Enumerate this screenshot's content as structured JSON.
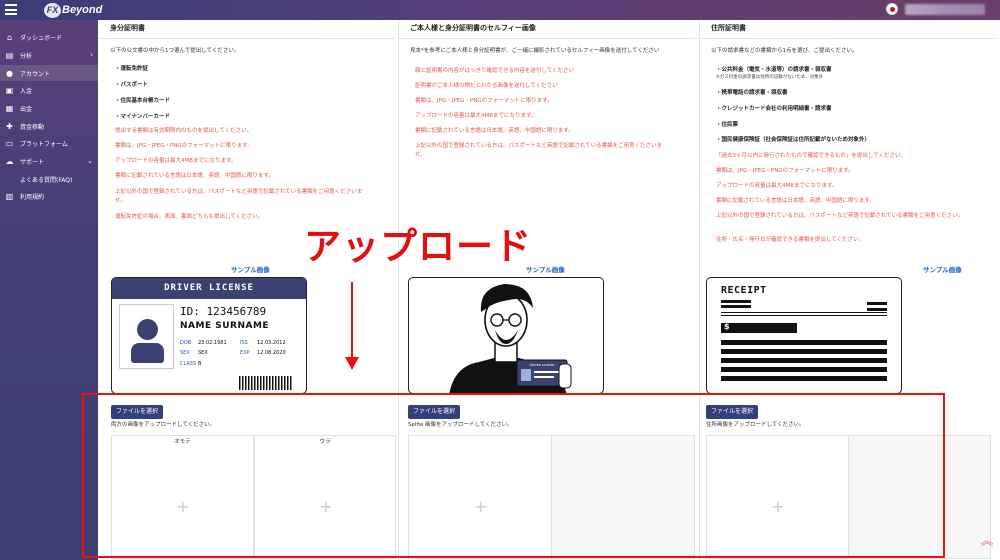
{
  "header": {
    "logo_mark": "FX",
    "logo_text": "Beyond"
  },
  "sidebar": {
    "items": [
      {
        "label": "ダッシュボード",
        "icon": "home-icon"
      },
      {
        "label": "分析",
        "icon": "chart-icon"
      },
      {
        "label": "アカウント",
        "icon": "users-icon"
      },
      {
        "label": "入金",
        "icon": "deposit-icon"
      },
      {
        "label": "出金",
        "icon": "withdraw-icon"
      },
      {
        "label": "資金移動",
        "icon": "transfer-icon"
      },
      {
        "label": "プラットフォーム",
        "icon": "platform-icon"
      },
      {
        "label": "サポート",
        "icon": "support-icon"
      },
      {
        "label": "よくある質問(FAQ)",
        "icon": ""
      },
      {
        "label": "利用規約",
        "icon": "terms-icon"
      }
    ]
  },
  "columns": [
    {
      "title": "身分証明書",
      "intro": "以下の公文書の中から1つ選んで提出してください。",
      "requirements": [
        "・運転免許証",
        "・パスポート",
        "・住民基本台帳カード",
        "・マイナンバーカード"
      ],
      "notes": [
        "提出する書類は有効期限内のものを提出してください。",
        "書類は、JPG・JPEG・PNGのフォーマットに限ります。",
        "アップロードの容量は最大4MBまでになります。",
        "書類に記載されている言語は日本語、英語、中国語に限ります。",
        "上記以外の国で登録されている方は、パスポートなど英語で記載されている書類をご用意くださいま",
        "せ。",
        "運転免許証の場合、表面、裏面どちらも提出してください。"
      ],
      "sample_label": "サンプル画像",
      "upload_button": "ファイルを選択",
      "upload_hint": "両方の画像をアップロードしてください。",
      "drop_labels": [
        "オモテ",
        "ウラ"
      ]
    },
    {
      "title": "ご本人様と身分証明書のセルフィー画像",
      "intro": "見本*を参考にご本人様と身分証明書が、ご一緒に撮影されているセルフィー画像を送付してください",
      "notes": [
        "顔と証明書の内容がはっきり確認できる内容を送付してください",
        "証明書がご本人様の物だとわかる画像を送付してください",
        "書類は、JPG・JPEG・PNGのフォーマットに限ります。",
        "アップロードの容量は最大4MBまでになります。",
        "書類に記載されている言語は日本語、英語、中国語に限ります。",
        "上記以外の国で登録されている方は、パスポートなど英語で記載されている書類をご用意くださいま",
        "せ。"
      ],
      "sample_label": "サンプル画像",
      "upload_button": "ファイルを選択",
      "upload_hint": "Selfie 画像をアップロードしてください。"
    },
    {
      "title": "住所証明書",
      "intro": "以下の請求書などの書類から1点を選び、ご提出ください。",
      "requirements": [
        "・公共料金（電気・水道等）の請求書・領収書",
        "※ガス料金の請求書は住所の記載がないため、対象外",
        "・携帯電話の請求書・領収書",
        "・クレジットカード会社の利用明細書・請求書",
        "・住民票",
        "・国民健康保険証（社会保険証は住所記載がないため対象外）"
      ],
      "notes": [
        "「過去3ヶ月以内に発行されたもので確認できるもの」を提出してください。",
        "書類は、JPG・JPEG・PNGのフォーマットに限ります。",
        "アップロードの容量は最大4MBまでになります。",
        "書類に記載されている言語は日本語、英語、中国語に限ります。",
        "上記以外の国で登録されている方は、パスポートなど英語で記載されている書類をご用意ください。",
        "住所・氏名・発行日が確認できる書類を提出してください。"
      ],
      "sample_label": "サンプル画像",
      "upload_button": "ファイルを選択",
      "upload_hint": "住所画像をアップロードしてください。"
    }
  ],
  "license_card": {
    "header": "DRIVER LICENSE",
    "id": "ID: 123456789",
    "name": "NAME SURNAME",
    "dob_label": "DOB",
    "dob": "23.02.1981",
    "iss_label": "ISS",
    "iss": "12.03.2012",
    "sex_label": "SEX",
    "sex": "SEX",
    "exp_label": "EXP",
    "exp": "12.08.2020",
    "class_label": "CLASS",
    "class": "B"
  },
  "selfie_card": {
    "card_text": "DRIVER LICENSE"
  },
  "receipt_card": {
    "header": "RECEIPT",
    "currency": "$"
  },
  "annotation": {
    "text": "アップロード",
    "color": "#e10f0f"
  },
  "colors": {
    "primary": "#34407a",
    "accent_red": "#e05a4a",
    "link_blue": "#1f5fc2"
  }
}
